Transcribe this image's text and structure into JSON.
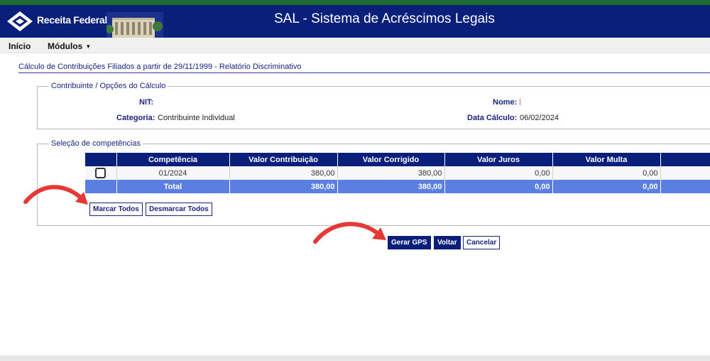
{
  "header": {
    "brand": "Receita Federal",
    "title": "SAL - Sistema de Acréscimos Legais",
    "colors": {
      "top_stripe": "#1e6b2e",
      "header_bg": "#0a1f7a",
      "accent_arrow": "#e53935"
    }
  },
  "menu": {
    "inicio": "Início",
    "modulos": "Módulos"
  },
  "page_title": "Cálculo de Contribuições Filiados a partir de 29/11/1999 - Relatório Discriminativo",
  "contribuinte": {
    "legend": "Contribuinte / Opções do Cálculo",
    "nit_label": "NIT:",
    "nit_value": "",
    "nome_label": "Nome:",
    "categoria_label": "Categoria:",
    "categoria_value": "Contribuinte Individual",
    "data_calculo_label": "Data Cálculo:",
    "data_calculo_value": "06/02/2024"
  },
  "selecao": {
    "legend": "Seleção de competências",
    "columns": {
      "competencia": "Competência",
      "valor_contribuicao": "Valor Contribuição",
      "valor_corrigido": "Valor Corrigido",
      "valor_juros": "Valor Juros",
      "valor_multa": "Valor Multa"
    },
    "row": {
      "competencia": "01/2024",
      "valor_contribuicao": "380,00",
      "valor_corrigido": "380,00",
      "valor_juros": "0,00",
      "valor_multa": "0,00"
    },
    "total": {
      "label": "Total",
      "valor_contribuicao": "380,00",
      "valor_corrigido": "380,00",
      "valor_juros": "0,00",
      "valor_multa": "0,00"
    },
    "marcar_todos": "Marcar Todos",
    "desmarcar_todos": "Desmarcar Todos"
  },
  "actions": {
    "gerar_gps": "Gerar GPS",
    "voltar": "Voltar",
    "cancelar": "Cancelar"
  }
}
